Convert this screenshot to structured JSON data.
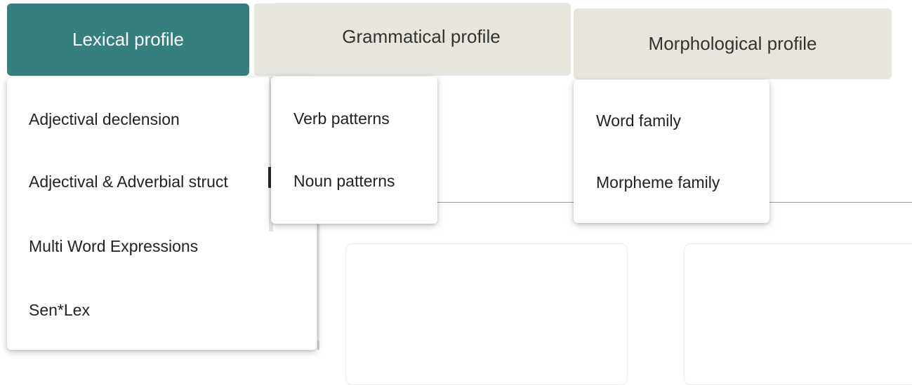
{
  "tabs": {
    "lexical_label": "Lexical profile",
    "grammatical_label": "Grammatical profile",
    "morphological_label": "Morphological profile"
  },
  "menus": {
    "lexical": {
      "items": [
        {
          "label": "Adjectival declension"
        },
        {
          "label": "Adjectival & Adverbial struct"
        },
        {
          "label": "Multi Word Expressions"
        },
        {
          "label": "Sen*Lex"
        }
      ]
    },
    "grammatical": {
      "items": [
        {
          "label": "Verb patterns"
        },
        {
          "label": "Noun patterns"
        }
      ]
    },
    "morphological": {
      "items": [
        {
          "label": "Word family"
        },
        {
          "label": "Morpheme family"
        }
      ]
    }
  },
  "colors": {
    "active_tab": "#357f7f",
    "inactive_tab": "#e8e6dc",
    "menu_background": "#ffffff"
  }
}
